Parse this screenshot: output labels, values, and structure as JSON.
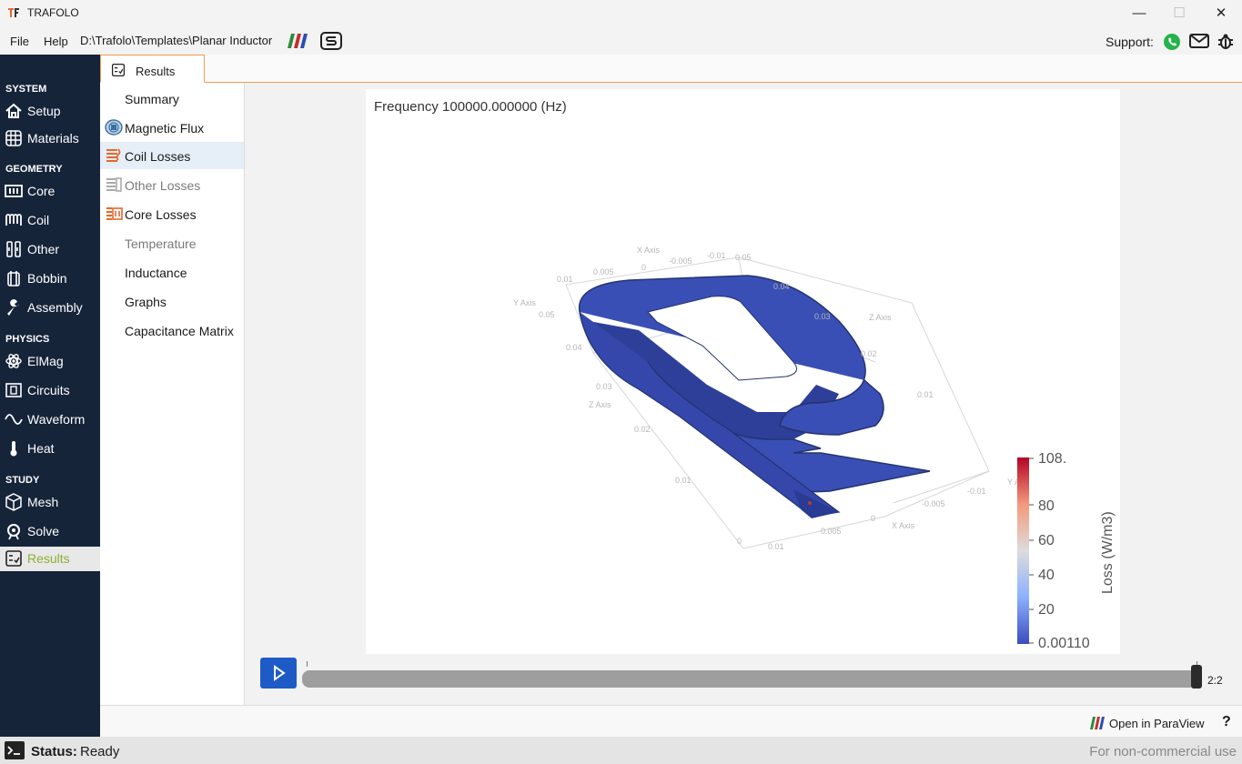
{
  "window": {
    "title": "TRAFOLO",
    "minimize": "—",
    "maximize": "☐",
    "close": "✕"
  },
  "menu": {
    "file": "File",
    "help": "Help",
    "path": "D:\\Trafolo\\Templates\\Planar Inductor",
    "support": "Support:"
  },
  "sidebar": {
    "sections": {
      "system": "SYSTEM",
      "geometry": "GEOMETRY",
      "physics": "PHYSICS",
      "study": "STUDY"
    },
    "items": {
      "setup": "Setup",
      "materials": "Materials",
      "core": "Core",
      "coil": "Coil",
      "other": "Other",
      "bobbin": "Bobbin",
      "assembly": "Assembly",
      "elmag": "ElMag",
      "circuits": "Circuits",
      "waveform": "Waveform",
      "heat": "Heat",
      "mesh": "Mesh",
      "solve": "Solve",
      "results": "Results"
    }
  },
  "tab": {
    "label": "Results"
  },
  "subnav": {
    "summary": "Summary",
    "magnetic_flux": "Magnetic Flux",
    "coil_losses": "Coil Losses",
    "other_losses": "Other Losses",
    "core_losses": "Core Losses",
    "temperature": "Temperature",
    "inductance": "Inductance",
    "graphs": "Graphs",
    "capacitance_matrix": "Capacitance Matrix"
  },
  "viewer": {
    "frequency_label": "Frequency 100000.000000 (Hz)",
    "axes": {
      "x_axis": "X Axis",
      "y_axis": "Y Axis",
      "z_axis": "Z Axis",
      "z_axis_2": "Z Axis",
      "y_axis_2": "Y A",
      "t1": "0.01",
      "t2": "0.005",
      "t3": "0",
      "t4": "-0.005",
      "t5": "-0.01",
      "t6": "0.05",
      "t7": "0.04",
      "t8": "0.03",
      "t9": "0.02",
      "t10": "0.01",
      "t11": "0.05",
      "t12": "0.04",
      "t13": "0.03",
      "t14": "0.02",
      "t15": "0.01",
      "t16": "0",
      "t17": "0.01",
      "t18": "0.005",
      "t19": "0",
      "t20": "-0.005",
      "t21": "-0.01",
      "x_axis_2": "X Axis"
    },
    "colorbar": {
      "title": "Loss (W/m3)",
      "labels": [
        "108.",
        "80",
        "60",
        "40",
        "20",
        "0.00110"
      ],
      "colors": [
        "#b40426",
        "#f4987a",
        "#dddcdc",
        "#8db0fe",
        "#3b4cc0"
      ]
    }
  },
  "playback": {
    "time": "2:2",
    "progress": 1.0
  },
  "footer": {
    "paraview": "Open in ParaView",
    "help": "?"
  },
  "status": {
    "label": "Status:",
    "value": "Ready",
    "license": "For non-commercial use"
  },
  "colors": {
    "sidebar_bg": "#16243a",
    "accent_orange": "#f09a55",
    "active_green": "#8cb030",
    "play_blue": "#1e5bc6",
    "coil_blue": "#3a4fb5"
  }
}
